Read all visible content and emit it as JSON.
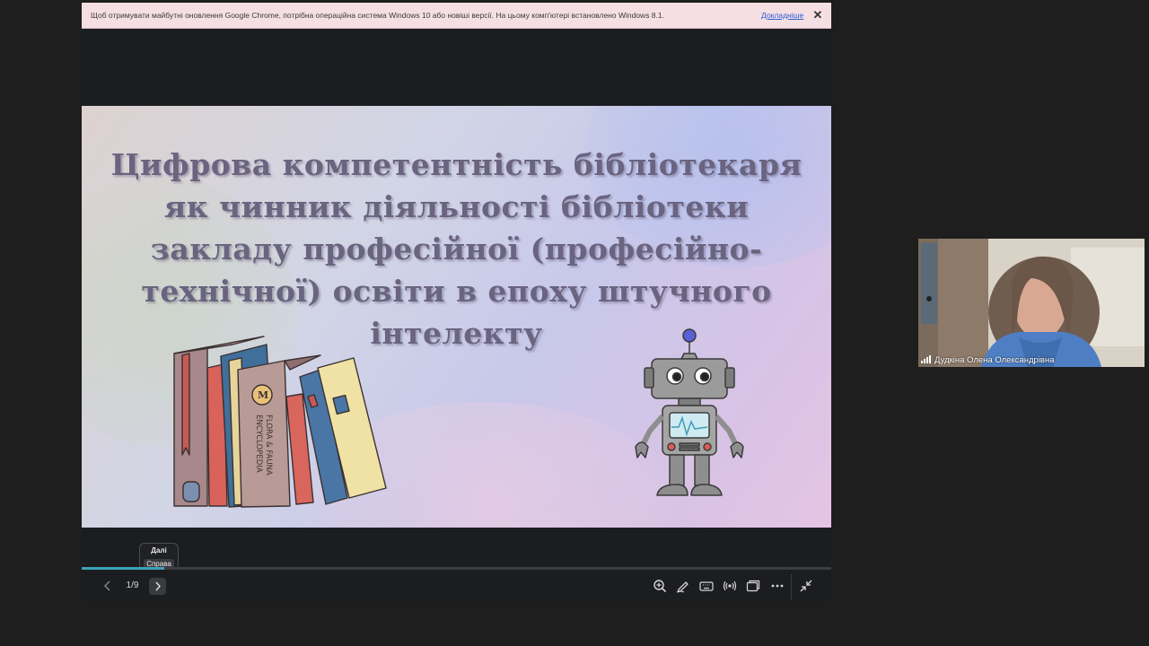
{
  "infobar": {
    "message": "Щоб отримувати майбутні оновлення Google Chrome, потрібна операційна система Windows 10 або новіші версії. На цьому комп'ютері встановлено Windows 8.1.",
    "learn_more": "Докладніше",
    "close": "✕"
  },
  "slide": {
    "title_lines": [
      "Цифрова компетентність бібліотекаря",
      "як чинник діяльності бібліотеки",
      "закладу професійної (професійно-",
      "технічної) освіти в епоху штучного",
      "інтелекту"
    ],
    "book_text": {
      "encyclopedia_line1": "FLORA & FAUNA",
      "encyclopedia_line2": "ENCYCLOPEDIA",
      "emblem_letter": "M"
    }
  },
  "controls": {
    "tooltip_line1": "Далі",
    "tooltip_line2": "Справа",
    "page_indicator": "1/9",
    "progress_fraction": 0.11,
    "icons": [
      "zoom-in-icon",
      "pen-icon",
      "keyboard-icon",
      "broadcast-icon",
      "window-icon",
      "more-icon",
      "collapse-icon"
    ]
  },
  "video": {
    "participant_name": "Дудкіна Олена Олександрівна"
  },
  "colors": {
    "title": "#6a6480",
    "progress": "#3da3b8",
    "infobar_bg": "#f6dfe3"
  }
}
